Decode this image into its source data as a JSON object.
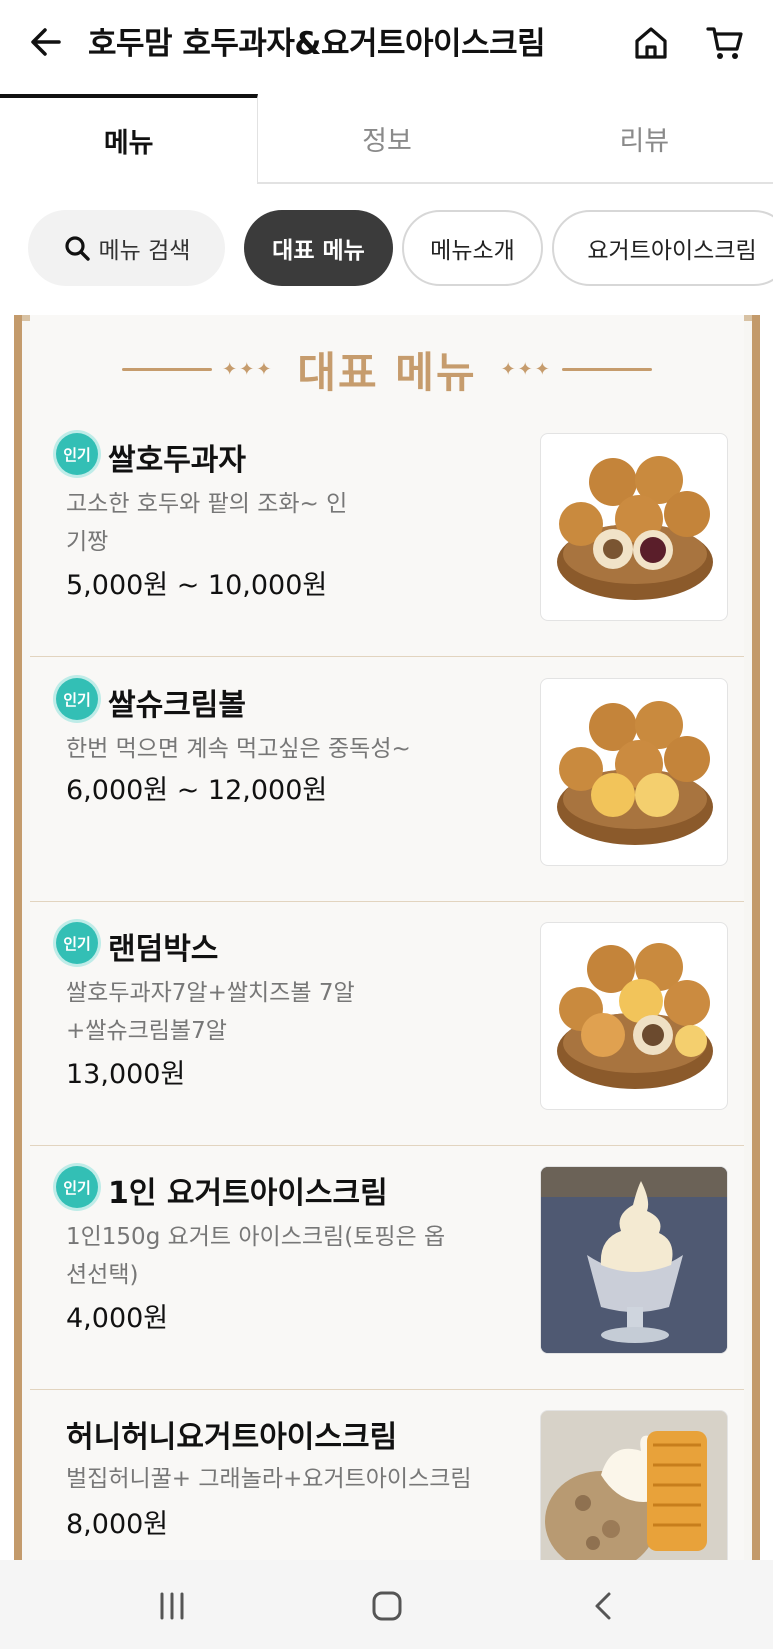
{
  "header": {
    "title": "호두맘 호두과자&요거트아이스크림",
    "back_icon": "arrow-left-icon",
    "home_icon": "home-icon",
    "cart_icon": "cart-icon"
  },
  "tabs": [
    {
      "label": "메뉴",
      "active": true
    },
    {
      "label": "정보",
      "active": false
    },
    {
      "label": "리뷰",
      "active": false
    }
  ],
  "chips": {
    "search_label": "메뉴 검색",
    "items": [
      {
        "label": "대표 메뉴",
        "active": true
      },
      {
        "label": "메뉴소개",
        "active": false
      },
      {
        "label": "요거트아이스크림",
        "active": false
      }
    ]
  },
  "board": {
    "title": "대표 메뉴",
    "accent_color": "#c69c6d"
  },
  "menu_items": [
    {
      "badge": "인기",
      "name": "쌀호두과자",
      "desc": "고소한 호두와 팥의 조화~ 인기짱",
      "price": "5,000원 ~ 10,000원",
      "image": "walnut-cakes-red-bean"
    },
    {
      "badge": "인기",
      "name": "쌀슈크림볼",
      "desc": "한번 먹으면 계속 먹고싶은 중독성~",
      "price": "6,000원 ~ 12,000원",
      "image": "walnut-cakes-custard"
    },
    {
      "badge": "인기",
      "name": "랜덤박스",
      "desc": "쌀호두과자7알+쌀치즈볼 7알+쌀슈크림볼7알",
      "price": "13,000원",
      "image": "walnut-cakes-mixed"
    },
    {
      "badge": "인기",
      "name": "1인 요거트아이스크림",
      "desc": "1인150g 요거트 아이스크림(토핑은 옵션선택)",
      "price": "4,000원",
      "image": "yogurt-soft-serve"
    },
    {
      "badge": "",
      "name": "허니허니요거트아이스크림",
      "desc": "벌집허니꿀+ 그래놀라+요거트아이스크림",
      "price": "8,000원",
      "image": "honeycomb-yogurt"
    }
  ],
  "navbar": {
    "recent_icon": "recent-apps-icon",
    "home_icon": "home-square-icon",
    "back_icon": "back-chevron-icon"
  }
}
